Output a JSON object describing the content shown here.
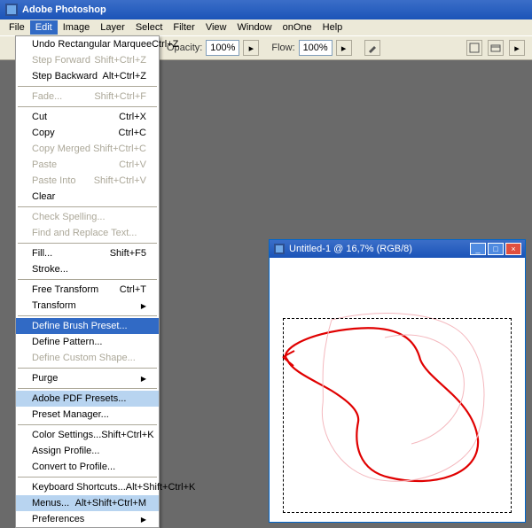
{
  "app": {
    "title": "Adobe Photoshop"
  },
  "menubar": {
    "items": [
      "File",
      "Edit",
      "Image",
      "Layer",
      "Select",
      "Filter",
      "View",
      "Window",
      "onOne",
      "Help"
    ],
    "open_index": 1
  },
  "toolbar": {
    "opacity_label": "Opacity:",
    "opacity_value": "100%",
    "flow_label": "Flow:",
    "flow_value": "100%"
  },
  "edit_menu": [
    {
      "label": "Undo Rectangular Marquee",
      "shortcut": "Ctrl+Z",
      "enabled": true
    },
    {
      "label": "Step Forward",
      "shortcut": "Shift+Ctrl+Z",
      "enabled": false
    },
    {
      "label": "Step Backward",
      "shortcut": "Alt+Ctrl+Z",
      "enabled": true
    },
    {
      "sep": true
    },
    {
      "label": "Fade...",
      "shortcut": "Shift+Ctrl+F",
      "enabled": false
    },
    {
      "sep": true
    },
    {
      "label": "Cut",
      "shortcut": "Ctrl+X",
      "enabled": true
    },
    {
      "label": "Copy",
      "shortcut": "Ctrl+C",
      "enabled": true
    },
    {
      "label": "Copy Merged",
      "shortcut": "Shift+Ctrl+C",
      "enabled": false
    },
    {
      "label": "Paste",
      "shortcut": "Ctrl+V",
      "enabled": false
    },
    {
      "label": "Paste Into",
      "shortcut": "Shift+Ctrl+V",
      "enabled": false
    },
    {
      "label": "Clear",
      "shortcut": "",
      "enabled": true
    },
    {
      "sep": true
    },
    {
      "label": "Check Spelling...",
      "shortcut": "",
      "enabled": false
    },
    {
      "label": "Find and Replace Text...",
      "shortcut": "",
      "enabled": false
    },
    {
      "sep": true
    },
    {
      "label": "Fill...",
      "shortcut": "Shift+F5",
      "enabled": true
    },
    {
      "label": "Stroke...",
      "shortcut": "",
      "enabled": true
    },
    {
      "sep": true
    },
    {
      "label": "Free Transform",
      "shortcut": "Ctrl+T",
      "enabled": true
    },
    {
      "label": "Transform",
      "shortcut": "",
      "enabled": true,
      "submenu": true
    },
    {
      "sep": true
    },
    {
      "label": "Define Brush Preset...",
      "shortcut": "",
      "enabled": true,
      "hov": true
    },
    {
      "label": "Define Pattern...",
      "shortcut": "",
      "enabled": true
    },
    {
      "label": "Define Custom Shape...",
      "shortcut": "",
      "enabled": false
    },
    {
      "sep": true
    },
    {
      "label": "Purge",
      "shortcut": "",
      "enabled": true,
      "submenu": true
    },
    {
      "sep": true
    },
    {
      "label": "Adobe PDF Presets...",
      "shortcut": "",
      "enabled": true,
      "hov2": true
    },
    {
      "label": "Preset Manager...",
      "shortcut": "",
      "enabled": true
    },
    {
      "sep": true
    },
    {
      "label": "Color Settings...",
      "shortcut": "Shift+Ctrl+K",
      "enabled": true
    },
    {
      "label": "Assign Profile...",
      "shortcut": "",
      "enabled": true
    },
    {
      "label": "Convert to Profile...",
      "shortcut": "",
      "enabled": true
    },
    {
      "sep": true
    },
    {
      "label": "Keyboard Shortcuts...",
      "shortcut": "Alt+Shift+Ctrl+K",
      "enabled": true
    },
    {
      "label": "Menus...",
      "shortcut": "Alt+Shift+Ctrl+M",
      "enabled": true,
      "hov2": true
    },
    {
      "label": "Preferences",
      "shortcut": "",
      "enabled": true,
      "submenu": true
    }
  ],
  "document": {
    "title": "Untitled-1 @ 16,7% (RGB/8)"
  }
}
